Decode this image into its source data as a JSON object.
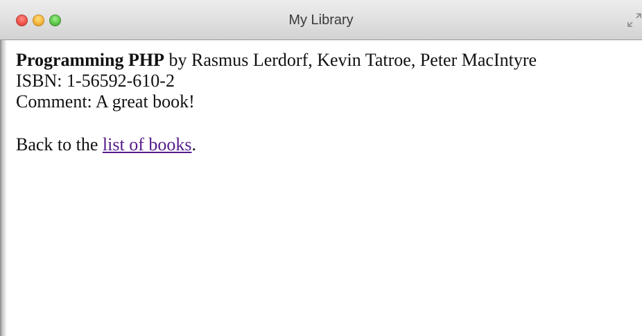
{
  "window": {
    "title": "My Library"
  },
  "icons": {
    "close": "close-icon",
    "minimize": "minimize-icon",
    "zoom": "zoom-icon",
    "fullscreen": "fullscreen-arrows-icon"
  },
  "colors": {
    "link_visited": "#551a8b",
    "text": "#111111",
    "close_button": "#f2544b",
    "minimize_button": "#f5b740",
    "zoom_button": "#5cc84a"
  },
  "book": {
    "title": "Programming PHP",
    "by_label": "by",
    "authors": "Rasmus Lerdorf, Kevin Tatroe, Peter MacIntyre",
    "isbn_label": "ISBN:",
    "isbn": "1-56592-610-2",
    "comment_label": "Comment:",
    "comment": "A great book!"
  },
  "footer": {
    "back_text": "Back to the",
    "link_text": "list of books",
    "suffix": "."
  }
}
